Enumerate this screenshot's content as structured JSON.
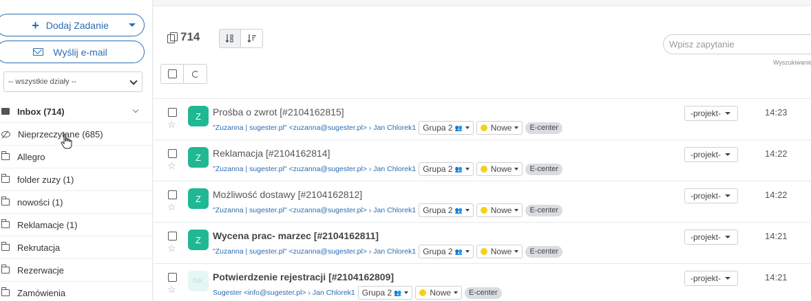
{
  "sidebar": {
    "add_task_label": "Dodaj Zadanie",
    "send_email_label": "Wyślij e-mail",
    "department_select": "-- wszystkie działy --",
    "folders": [
      {
        "label": "Inbox (714)"
      },
      {
        "label": "Nieprzeczytane (685)"
      },
      {
        "label": "Allegro"
      },
      {
        "label": "folder zuzy (1)"
      },
      {
        "label": "nowości (1)"
      },
      {
        "label": "Reklamacje (1)"
      },
      {
        "label": "Rekrutacja"
      },
      {
        "label": "Rezerwacje"
      },
      {
        "label": "Zamówienia"
      }
    ]
  },
  "toolbar": {
    "count": "714",
    "search_placeholder": "Wpisz zapytanie",
    "search_hint": "Wyszukiwanie"
  },
  "tickets": [
    {
      "avatar": "Z",
      "subject": "Prośba o zwrot [#2104162815]",
      "unread": false,
      "from": "\"Zuzanna | sugester.pl\" <zuzanna@sugester.pl> › Jan Chlorek1",
      "group": "Grupa 2",
      "status": "Nowe",
      "tag": "E-center",
      "project": "-projekt-",
      "time": "14:23"
    },
    {
      "avatar": "Z",
      "subject": "Reklamacja [#2104162814]",
      "unread": false,
      "from": "\"Zuzanna | sugester.pl\" <zuzanna@sugester.pl> › Jan Chlorek1",
      "group": "Grupa 2",
      "status": "Nowe",
      "tag": "E-center",
      "project": "-projekt-",
      "time": "14:22"
    },
    {
      "avatar": "Z",
      "subject": "Możliwość dostawy [#2104162812]",
      "unread": false,
      "from": "\"Zuzanna | sugester.pl\" <zuzanna@sugester.pl> › Jan Chlorek1",
      "group": "Grupa 2",
      "status": "Nowe",
      "tag": "E-center",
      "project": "-projekt-",
      "time": "14:22"
    },
    {
      "avatar": "Z",
      "subject": "Wycena prac- marzec [#2104162811]",
      "unread": true,
      "from": "\"Zuzanna | sugester.pl\" <zuzanna@sugester.pl> › Jan Chlorek1",
      "group": "Grupa 2",
      "status": "Nowe",
      "tag": "E-center",
      "project": "-projekt-",
      "time": "14:21"
    },
    {
      "avatar": "NK",
      "subject": "Potwierdzenie rejestracji [#2104162809]",
      "unread": true,
      "from": "Sugester <info@sugester.pl> › Jan Chlorek1",
      "group": "Grupa 2",
      "status": "Nowe",
      "tag": "E-center",
      "project": "-projekt-",
      "time": "14:21"
    }
  ],
  "colors": {
    "accent": "#2b6cb0",
    "avatar": "#1fb893",
    "status_dot": "#f5d11a"
  }
}
